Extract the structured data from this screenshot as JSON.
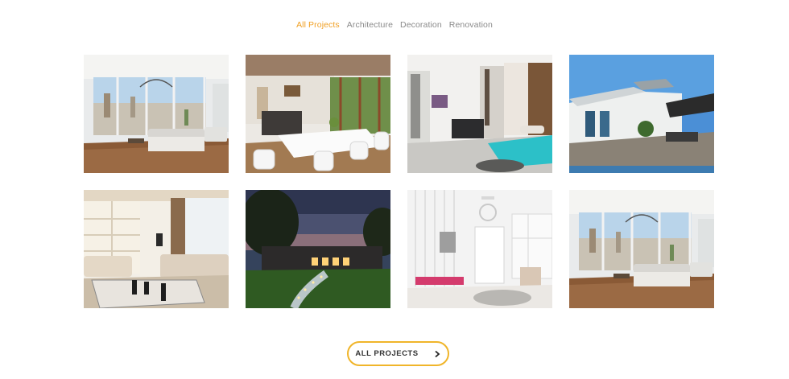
{
  "filters": [
    "All Projects",
    "Architecture",
    "Decoration",
    "Renovation"
  ],
  "active_filter": "All Projects",
  "gallery": [
    {
      "name": "project-living-room-panorama"
    },
    {
      "name": "project-dining-area"
    },
    {
      "name": "project-bedroom"
    },
    {
      "name": "project-rooftop-terrace"
    },
    {
      "name": "project-lounge-shelves"
    },
    {
      "name": "project-castle-evening"
    },
    {
      "name": "project-white-kids-room"
    },
    {
      "name": "project-living-room-panorama-2"
    }
  ],
  "button": {
    "label": "ALL PROJECTS",
    "icon": "chevron-right-icon"
  },
  "colors": {
    "accent": "#f0a024",
    "button_border": "#f0b52a",
    "muted_text": "#8a8a8a"
  }
}
